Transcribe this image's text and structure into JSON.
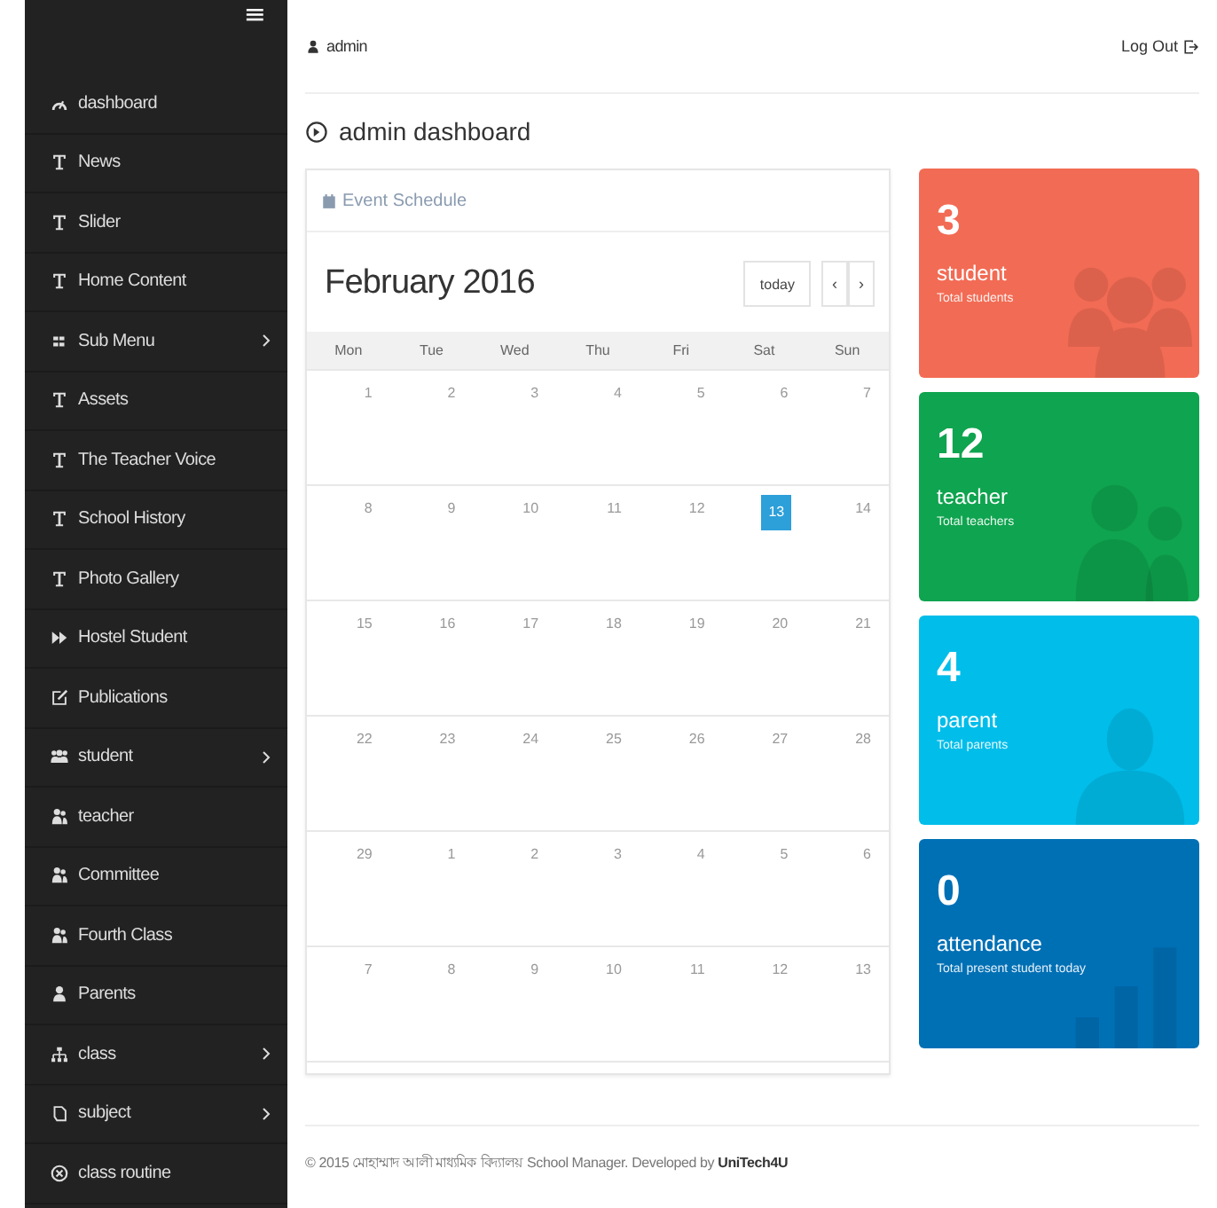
{
  "sidebar": {
    "menu_toggle": "≡",
    "items": [
      {
        "label": "dashboard",
        "submenu": false
      },
      {
        "label": "News",
        "submenu": false
      },
      {
        "label": "Slider",
        "submenu": false
      },
      {
        "label": "Home Content",
        "submenu": false
      },
      {
        "label": "Sub Menu",
        "submenu": true
      },
      {
        "label": "Assets",
        "submenu": false
      },
      {
        "label": "The Teacher Voice",
        "submenu": false
      },
      {
        "label": "School History",
        "submenu": false
      },
      {
        "label": "Photo Gallery",
        "submenu": false
      },
      {
        "label": "Hostel Student",
        "submenu": false
      },
      {
        "label": "Publications",
        "submenu": false
      },
      {
        "label": "student",
        "submenu": true
      },
      {
        "label": "teacher",
        "submenu": false
      },
      {
        "label": "Committee",
        "submenu": false
      },
      {
        "label": "Fourth Class",
        "submenu": false
      },
      {
        "label": "Parents",
        "submenu": false
      },
      {
        "label": "class",
        "submenu": true
      },
      {
        "label": "subject",
        "submenu": true
      },
      {
        "label": "class routine",
        "submenu": false
      }
    ]
  },
  "topbar": {
    "user": "admin",
    "logout": "Log Out"
  },
  "page_title": "admin dashboard",
  "calendar": {
    "panel_title": "Event Schedule",
    "month": "February 2016",
    "today_button": "today",
    "prev_button": "‹",
    "next_button": "›",
    "weekdays": [
      "Mon",
      "Tue",
      "Wed",
      "Thu",
      "Fri",
      "Sat",
      "Sun"
    ],
    "weeks": [
      [
        {
          "day": "1",
          "selected": false
        },
        {
          "day": "2",
          "selected": false
        },
        {
          "day": "3",
          "selected": false
        },
        {
          "day": "4",
          "selected": false
        },
        {
          "day": "5",
          "selected": false
        },
        {
          "day": "6",
          "selected": false
        },
        {
          "day": "7",
          "selected": false
        }
      ],
      [
        {
          "day": "8",
          "selected": false
        },
        {
          "day": "9",
          "selected": false
        },
        {
          "day": "10",
          "selected": false
        },
        {
          "day": "11",
          "selected": false
        },
        {
          "day": "12",
          "selected": false
        },
        {
          "day": "13",
          "selected": true
        },
        {
          "day": "14",
          "selected": false
        }
      ],
      [
        {
          "day": "15",
          "selected": false
        },
        {
          "day": "16",
          "selected": false
        },
        {
          "day": "17",
          "selected": false
        },
        {
          "day": "18",
          "selected": false
        },
        {
          "day": "19",
          "selected": false
        },
        {
          "day": "20",
          "selected": false
        },
        {
          "day": "21",
          "selected": false
        }
      ],
      [
        {
          "day": "22",
          "selected": false
        },
        {
          "day": "23",
          "selected": false
        },
        {
          "day": "24",
          "selected": false
        },
        {
          "day": "25",
          "selected": false
        },
        {
          "day": "26",
          "selected": false
        },
        {
          "day": "27",
          "selected": false
        },
        {
          "day": "28",
          "selected": false
        }
      ],
      [
        {
          "day": "29",
          "selected": false
        },
        {
          "day": "1",
          "selected": false
        },
        {
          "day": "2",
          "selected": false
        },
        {
          "day": "3",
          "selected": false
        },
        {
          "day": "4",
          "selected": false
        },
        {
          "day": "5",
          "selected": false
        },
        {
          "day": "6",
          "selected": false
        }
      ],
      [
        {
          "day": "7",
          "selected": false
        },
        {
          "day": "8",
          "selected": false
        },
        {
          "day": "9",
          "selected": false
        },
        {
          "day": "10",
          "selected": false
        },
        {
          "day": "11",
          "selected": false
        },
        {
          "day": "12",
          "selected": false
        },
        {
          "day": "13",
          "selected": false
        }
      ]
    ]
  },
  "stats": [
    {
      "value": "3",
      "label": "student",
      "caption": "Total students",
      "color": "#f26b54"
    },
    {
      "value": "12",
      "label": "teacher",
      "caption": "Total teachers",
      "color": "#0fa44f"
    },
    {
      "value": "4",
      "label": "parent",
      "caption": "Total parents",
      "color": "#00bdea"
    },
    {
      "value": "0",
      "label": "attendance",
      "caption": "Total present student today",
      "color": "#0070b5"
    }
  ],
  "footer": {
    "text": "© 2015 মোহাম্মাদ আলী মাধ্যমিক বিদ্যালয় School Manager. Developed by",
    "link": "UniTech4U"
  }
}
